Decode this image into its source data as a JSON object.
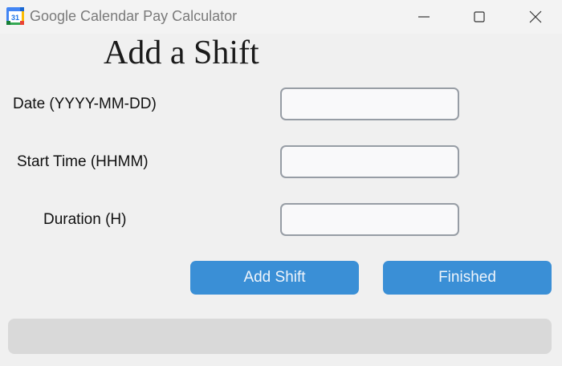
{
  "window": {
    "title": "Google Calendar Pay Calculator",
    "icon": "google-calendar-icon",
    "icon_text": "31"
  },
  "form": {
    "heading": "Add a Shift",
    "fields": [
      {
        "label": "Date (YYYY-MM-DD)",
        "value": "",
        "placeholder": ""
      },
      {
        "label": "Start Time (HHMM)",
        "value": "",
        "placeholder": ""
      },
      {
        "label": "Duration (H)",
        "value": "",
        "placeholder": ""
      }
    ],
    "buttons": {
      "add_shift": "Add Shift",
      "finished": "Finished"
    }
  },
  "progress": {
    "value": 0
  },
  "colors": {
    "accent": "#3a8fd6",
    "background": "#f0f0f0",
    "progress_track": "#d9d9d9"
  }
}
